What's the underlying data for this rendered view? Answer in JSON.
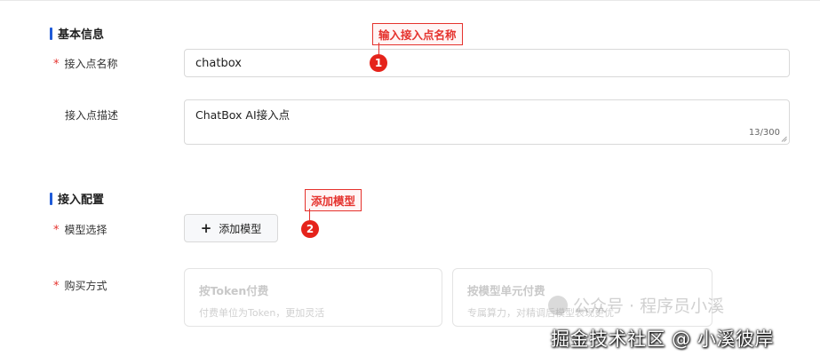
{
  "sections": {
    "basic": {
      "title": "基本信息"
    },
    "config": {
      "title": "接入配置"
    }
  },
  "form": {
    "name": {
      "label": "接入点名称",
      "required_mark": "*",
      "value": "chatbox"
    },
    "desc": {
      "label": "接入点描述",
      "value": "ChatBox AI接入点",
      "count": "13/300"
    },
    "model": {
      "label": "模型选择",
      "required_mark": "*",
      "button_icon": "plus-icon",
      "button_label": "添加模型"
    },
    "purchase": {
      "label": "购买方式",
      "required_mark": "*",
      "options": [
        {
          "title": "按Token付费",
          "desc": "付费单位为Token，更加灵活"
        },
        {
          "title": "按模型单元付费",
          "desc": "专属算力，对精调后模型表现更优"
        }
      ]
    }
  },
  "annotations": {
    "step1": {
      "text": "输入接入点名称",
      "badge": "1"
    },
    "step2": {
      "text": "添加模型",
      "badge": "2"
    }
  },
  "colors": {
    "accent_bar": "#1f5bd8",
    "annotation_red": "#e5231b",
    "required": "#e5322d"
  },
  "watermark": {
    "line1": "公众号 · 程序员小溪",
    "line2": "掘金技术社区 @ 小溪彼岸"
  }
}
